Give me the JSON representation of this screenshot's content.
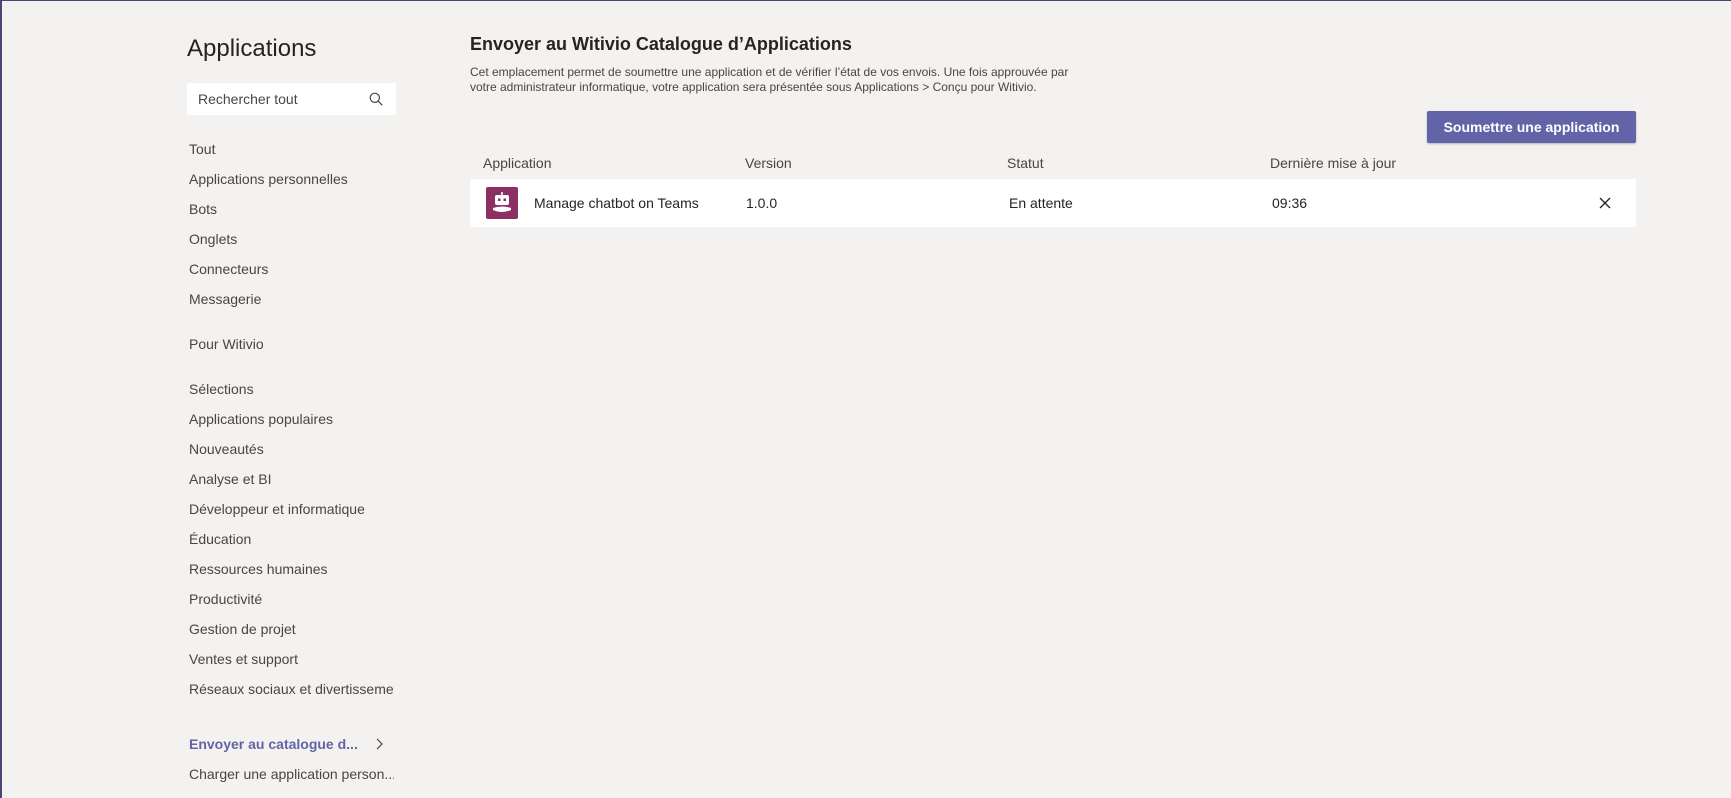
{
  "sidebar": {
    "title": "Applications",
    "search_placeholder": "Rechercher tout",
    "items": [
      {
        "label": "Tout"
      },
      {
        "label": "Applications personnelles"
      },
      {
        "label": "Bots"
      },
      {
        "label": "Onglets"
      },
      {
        "label": "Connecteurs"
      },
      {
        "label": "Messagerie"
      },
      {
        "label": "Pour Witivio"
      },
      {
        "label": "Sélections"
      },
      {
        "label": "Applications populaires"
      },
      {
        "label": "Nouveautés"
      },
      {
        "label": "Analyse et BI"
      },
      {
        "label": "Développeur et informatique"
      },
      {
        "label": "Éducation"
      },
      {
        "label": "Ressources humaines"
      },
      {
        "label": "Productivité"
      },
      {
        "label": "Gestion de projet"
      },
      {
        "label": "Ventes et support"
      },
      {
        "label": "Réseaux sociaux et divertissement"
      },
      {
        "label": "Envoyer au catalogue d..."
      },
      {
        "label": "Charger une application person..."
      }
    ]
  },
  "main": {
    "title": "Envoyer au Witivio Catalogue d’Applications",
    "description": "Cet emplacement permet de soumettre une application et de vérifier l’état de vos envois. Une fois approuvée par votre administrateur informatique, votre application sera présentée sous Applications > Conçu pour Witivio.",
    "submit_label": "Soumettre une application",
    "table": {
      "headers": {
        "application": "Application",
        "version": "Version",
        "status": "Statut",
        "updated": "Dernière mise à jour"
      },
      "rows": [
        {
          "icon": "bot-icon",
          "name": "Manage chatbot on Teams",
          "version": "1.0.0",
          "status": "En attente",
          "updated": "09:36"
        }
      ]
    }
  },
  "colors": {
    "accent": "#6264a7",
    "app_icon_bg": "#8c2f63",
    "background": "#f3f2f1"
  }
}
